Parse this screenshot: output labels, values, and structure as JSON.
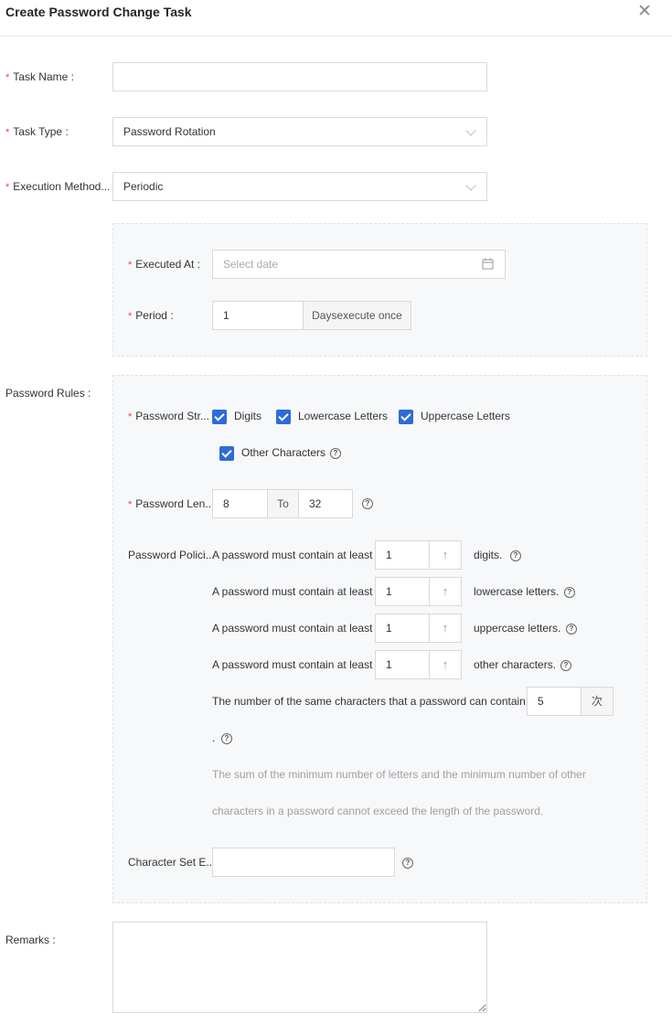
{
  "dialog": {
    "title": "Create Password Change Task",
    "close_glyph": "✕"
  },
  "form": {
    "task_name": {
      "label": "Task Name",
      "colon": ":",
      "value": ""
    },
    "task_type": {
      "label": "Task Type",
      "colon": ":",
      "value": "Password Rotation"
    },
    "execution_method": {
      "label": "Execution Method...",
      "value": "Periodic"
    },
    "schedule": {
      "executed_at": {
        "label": "Executed At",
        "colon": ":",
        "placeholder": "Select date"
      },
      "period": {
        "label": "Period",
        "colon": ":",
        "value": "1",
        "unit": "Daysexecute once"
      }
    },
    "password_rules": {
      "label": "Password Rules",
      "colon": ":",
      "strength": {
        "label": "Password Str...",
        "options": [
          {
            "label": "Digits",
            "checked": true
          },
          {
            "label": "Lowercase Letters",
            "checked": true
          },
          {
            "label": "Uppercase Letters",
            "checked": true
          },
          {
            "label": "Other Characters",
            "checked": true
          }
        ]
      },
      "length": {
        "label": "Password Len...",
        "min": "8",
        "to": "To",
        "max": "32"
      },
      "policies": {
        "label": "Password Polici...",
        "rows": [
          {
            "prefix": "A password must contain at least",
            "value": "1",
            "suffix": "digits."
          },
          {
            "prefix": "A password must contain at least",
            "value": "1",
            "suffix": "lowercase letters."
          },
          {
            "prefix": "A password must contain at least",
            "value": "1",
            "suffix": "uppercase letters."
          },
          {
            "prefix": "A password must contain at least",
            "value": "1",
            "suffix": "other characters."
          }
        ],
        "same_chars": {
          "prefix": "The number of the same characters that a password can contain:",
          "value": "5",
          "unit": "次",
          "dot": "."
        },
        "hint_line1": "The sum of the minimum number of letters and the minimum number of other",
        "hint_line2": "characters in a password cannot exceed the length of the password."
      },
      "charset": {
        "label": "Character Set E...",
        "value": ""
      }
    },
    "remarks": {
      "label": "Remarks",
      "colon": ":",
      "value": ""
    }
  },
  "icons": {
    "help": "?",
    "arrow_up": "↑",
    "calendar": "calendar-icon",
    "chevron": "chevron-down-icon"
  },
  "colors": {
    "required": "#e84738",
    "checkbox": "#2e6bd6",
    "panel_bg": "#f7f8fa",
    "hint": "#a0a0a0"
  }
}
